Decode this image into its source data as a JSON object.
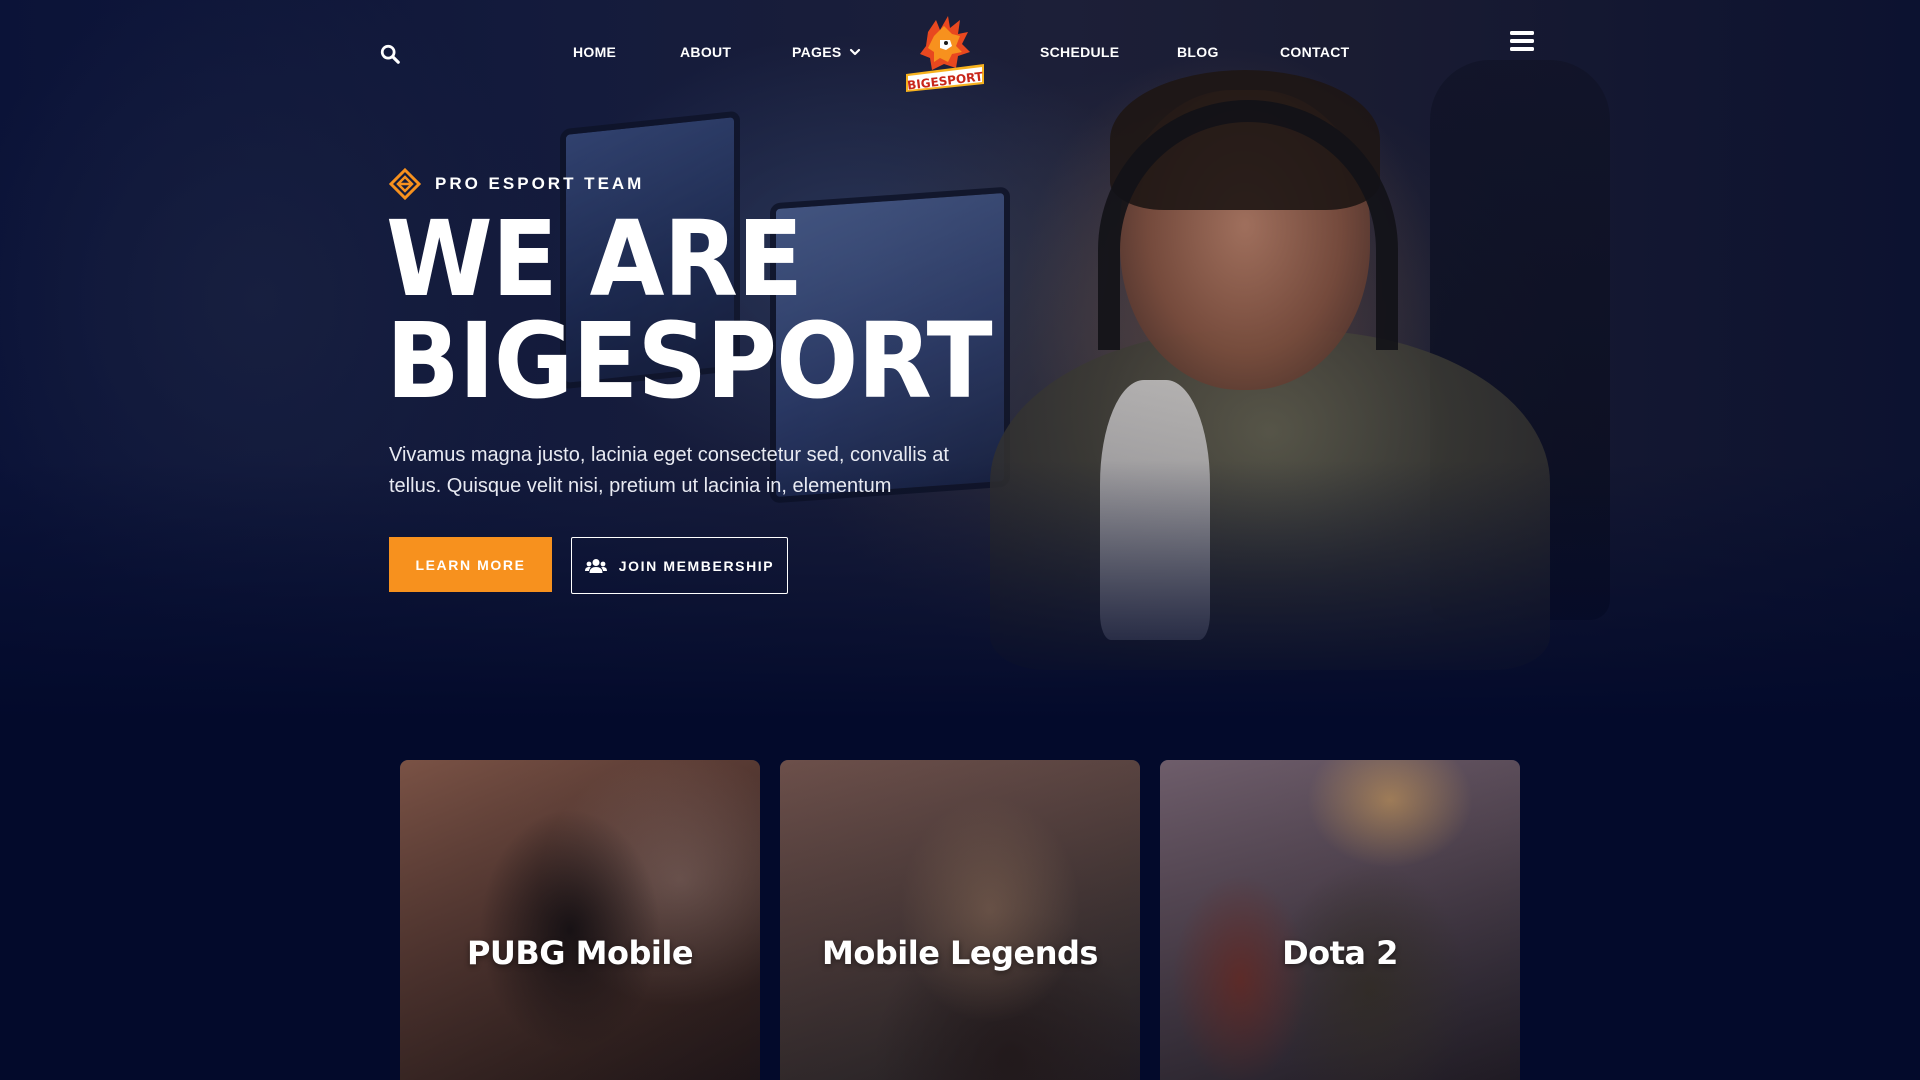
{
  "brand": {
    "name": "BIGESPORT",
    "logo_icon": "dragon-logo-icon"
  },
  "nav": {
    "search_icon": "search-icon",
    "links": {
      "home": "HOME",
      "about": "ABOUT",
      "pages": "PAGES",
      "schedule": "SCHEDULE",
      "blog": "BLOG",
      "contact": "CONTACT"
    },
    "menu_icon": "hamburger-menu-icon"
  },
  "hero": {
    "eyebrow": "PRO ESPORT TEAM",
    "headline_line1": "WE ARE",
    "headline_line2": "BIGESPORT",
    "lead": "Vivamus magna justo, lacinia eget consectetur sed, convallis at tellus. Quisque velit nisi, pretium ut lacinia in, elementum",
    "primary_button": "LEARN MORE",
    "secondary_button": "JOIN MEMBERSHIP"
  },
  "games": [
    {
      "title": "PUBG Mobile"
    },
    {
      "title": "Mobile Legends"
    },
    {
      "title": "Dota 2"
    }
  ],
  "colors": {
    "accent": "#f7911e",
    "background": "#030a2b",
    "text": "#ffffff"
  }
}
